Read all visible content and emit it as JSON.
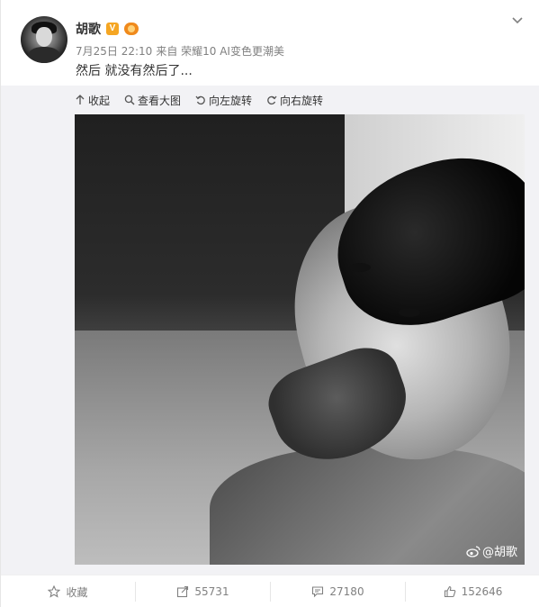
{
  "post": {
    "username": "胡歌",
    "v_badge": "V",
    "timestamp": "7月25日 22:10",
    "source": "来自 荣耀10 AI变色更潮美",
    "text": "然后 就没有然后了..."
  },
  "media_toolbar": {
    "collapse": "收起",
    "view_large": "查看大图",
    "rotate_left": "向左旋转",
    "rotate_right": "向右旋转"
  },
  "watermark": "@胡歌",
  "footer": {
    "favorite": "收藏",
    "reposts": "55731",
    "comments": "27180",
    "likes": "152646"
  },
  "icons": {
    "header_menu": "chevron-down-icon",
    "collapse": "arrow-up-icon",
    "view_large": "magnifier-icon",
    "rotate_left": "rotate-left-icon",
    "rotate_right": "rotate-right-icon",
    "favorite": "star-icon",
    "repost": "share-icon",
    "comment": "comment-icon",
    "like": "thumbs-up-icon"
  },
  "colors": {
    "text": "#333333",
    "muted": "#808080",
    "media_bg": "#f2f2f5",
    "v_badge": "#f5a623"
  }
}
